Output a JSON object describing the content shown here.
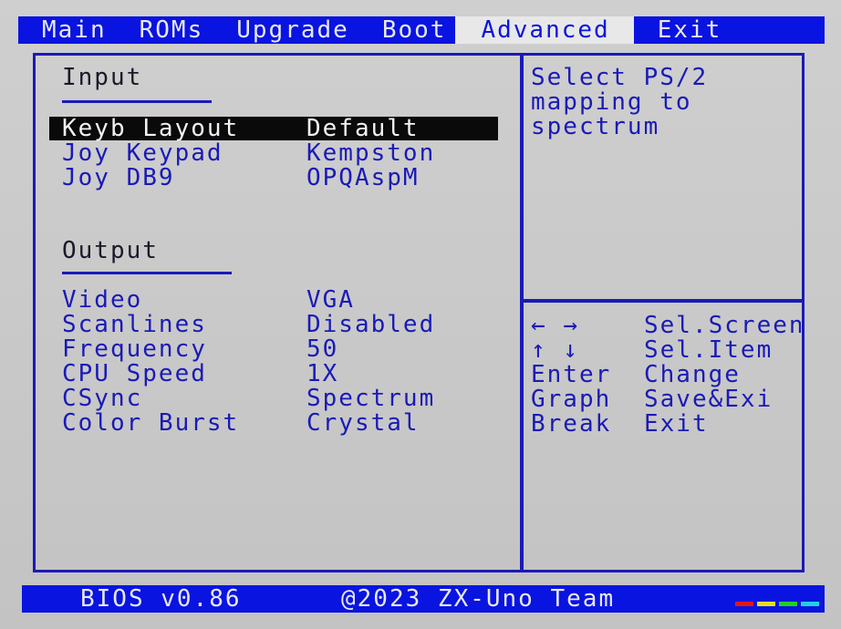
{
  "menu": {
    "items": [
      {
        "label": "Main"
      },
      {
        "label": "ROMs"
      },
      {
        "label": "Upgrade"
      },
      {
        "label": "Boot"
      },
      {
        "label": "Advanced"
      },
      {
        "label": "Exit"
      }
    ],
    "active": "Advanced"
  },
  "input_section": {
    "title": "Input",
    "rows": [
      {
        "label": "Keyb Layout",
        "value": "Default"
      },
      {
        "label": "Joy Keypad",
        "value": "Kempston"
      },
      {
        "label": "Joy DB9",
        "value": "OPQAspM"
      }
    ]
  },
  "output_section": {
    "title": "Output",
    "rows": [
      {
        "label": "Video",
        "value": "VGA"
      },
      {
        "label": "Scanlines",
        "value": "Disabled"
      },
      {
        "label": "Frequency",
        "value": "50"
      },
      {
        "label": "CPU Speed",
        "value": "1X"
      },
      {
        "label": "CSync",
        "value": "Spectrum"
      },
      {
        "label": "Color Burst",
        "value": "Crystal"
      }
    ]
  },
  "help": {
    "text": "Select PS/2\nmapping to\nspectrum"
  },
  "keys": [
    {
      "key": "← →",
      "action": "Sel.Screen"
    },
    {
      "key": "↑ ↓",
      "action": "Sel.Item"
    },
    {
      "key": "Enter",
      "action": "Change"
    },
    {
      "key": "Graph",
      "action": "Save&Exi"
    },
    {
      "key": "Break",
      "action": "Exit"
    }
  ],
  "status": {
    "version": "BIOS v0.86",
    "copyright": "@2023 ZX-Uno Team"
  },
  "colors": {
    "bios_blue": "#0a14e0",
    "text_blue": "#1a1ab8",
    "background": "#c8c8c8",
    "stripe_red": "#e01818",
    "stripe_yellow": "#e0e020",
    "stripe_green": "#20d020",
    "stripe_cyan": "#20d0e0"
  }
}
